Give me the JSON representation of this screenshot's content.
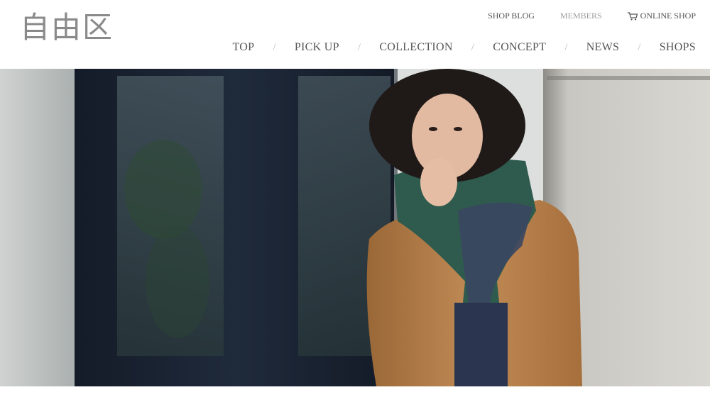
{
  "brand": {
    "logo_text": "自由区"
  },
  "utility_nav": {
    "shop_blog": "SHOP BLOG",
    "members": "MEMBERS",
    "online_shop": "ONLINE SHOP"
  },
  "main_nav": {
    "items": [
      {
        "label": "TOP"
      },
      {
        "label": "PICK UP"
      },
      {
        "label": "COLLECTION"
      },
      {
        "label": "CONCEPT"
      },
      {
        "label": "NEWS"
      },
      {
        "label": "SHOPS"
      }
    ],
    "separator": "/"
  },
  "hero": {
    "icon": "hero-photo",
    "colors": {
      "coat": "#b07a45",
      "scarf_green": "#2f5b4e",
      "scarf_navy": "#2b3550",
      "wall": "#cfcdc8",
      "door": "#1c2433"
    }
  }
}
